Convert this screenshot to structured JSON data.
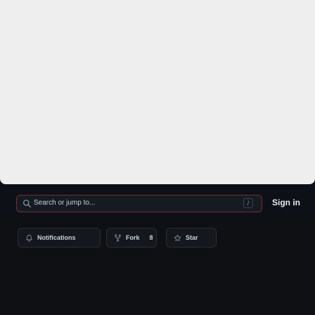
{
  "header": {
    "search": {
      "placeholder": "Search or jump to...",
      "shortcut": "/"
    },
    "sign_in_label": "Sign in"
  },
  "repo_actions": {
    "notifications_label": "Notifications",
    "fork_label": "Fork",
    "fork_count": "8",
    "star_label": "Star"
  },
  "colors": {
    "header_bg": "#0d1117",
    "search_border": "#7a2a2a",
    "text": "#c9d1d9"
  },
  "icons": [
    "search-icon",
    "bell-icon",
    "fork-icon",
    "star-icon"
  ]
}
